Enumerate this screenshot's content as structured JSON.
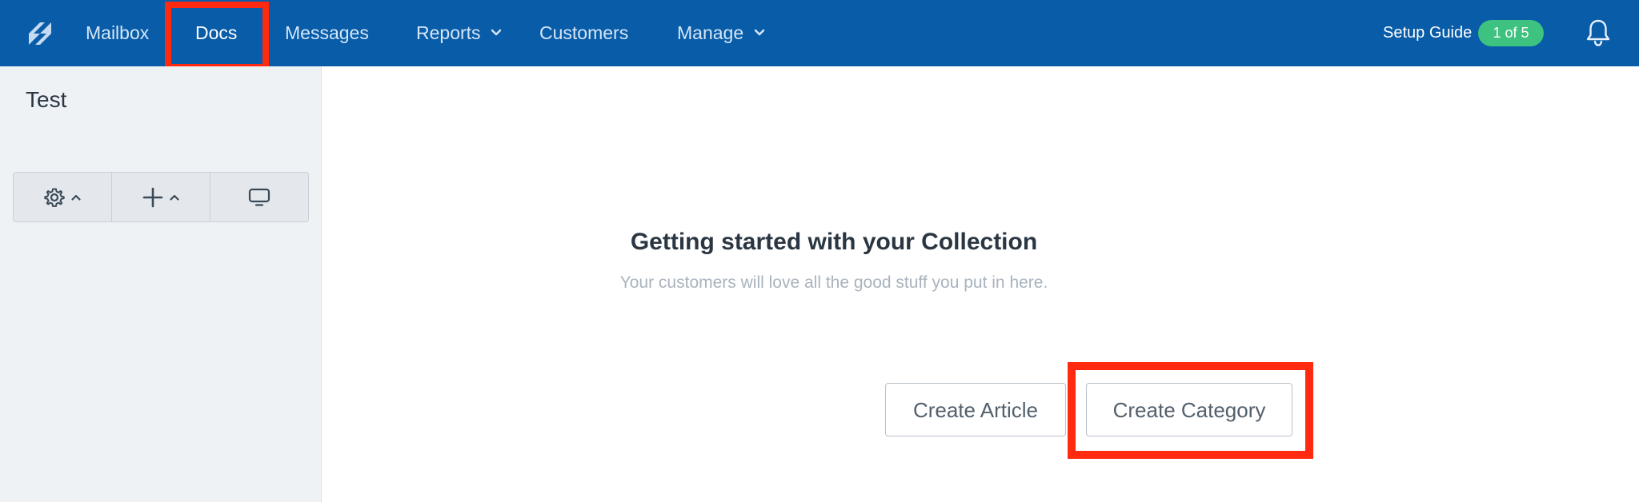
{
  "nav": {
    "items": [
      {
        "label": "Mailbox"
      },
      {
        "label": "Docs"
      },
      {
        "label": "Messages"
      },
      {
        "label": "Reports"
      },
      {
        "label": "Customers"
      },
      {
        "label": "Manage"
      }
    ],
    "active": "Docs",
    "setup_guide": {
      "label": "Setup Guide",
      "badge": "1 of 5"
    }
  },
  "sidebar": {
    "title": "Test",
    "toolbar": [
      {
        "icon": "gear-icon",
        "has_menu": true
      },
      {
        "icon": "plus-icon",
        "has_menu": true
      },
      {
        "icon": "monitor-icon",
        "has_menu": false
      }
    ]
  },
  "main": {
    "empty_state": {
      "title": "Getting started with your Collection",
      "subtitle": "Your customers will love all the good stuff you put in here.",
      "create_article_label": "Create Article",
      "create_category_label": "Create Category"
    }
  },
  "colors": {
    "nav_background": "#085ca8",
    "sidebar_background": "#eff2f5",
    "badge_green": "#3ec27f",
    "highlight_red": "#ff2a10"
  }
}
